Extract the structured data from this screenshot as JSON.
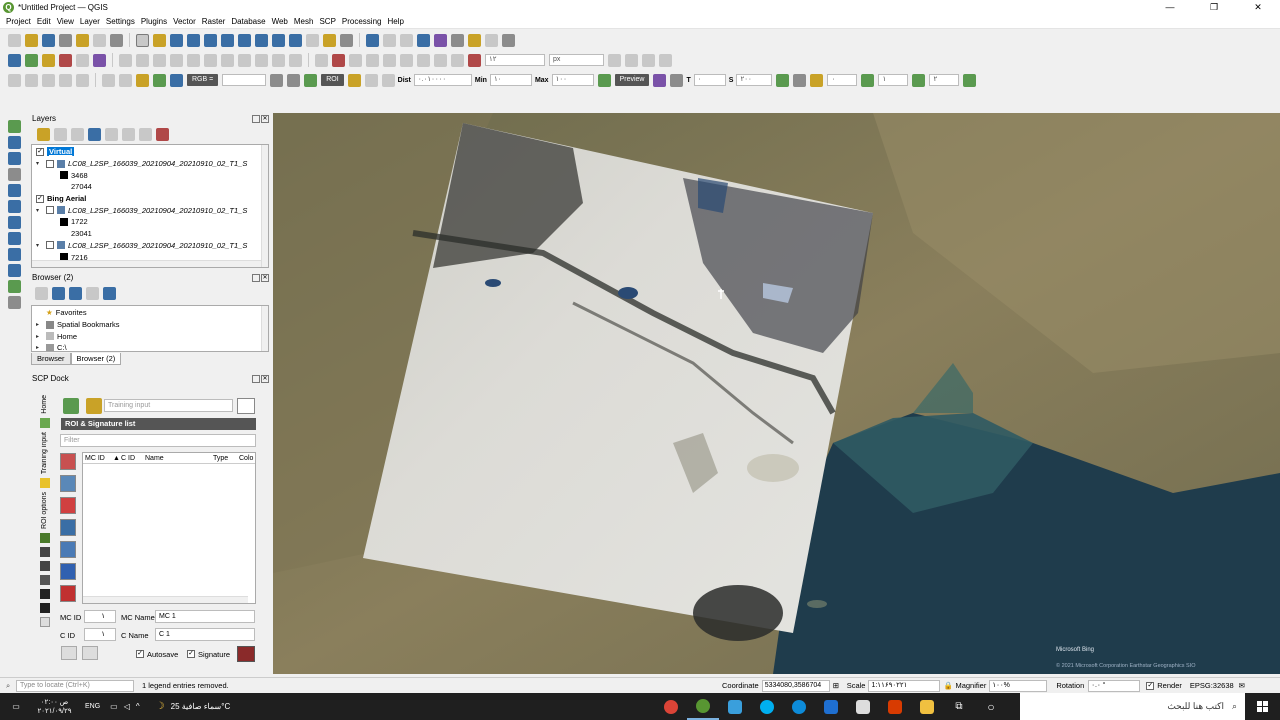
{
  "window": {
    "title": "*Untitled Project — QGIS",
    "logo": "Q",
    "min": "—",
    "max": "❐",
    "close": "✕"
  },
  "menu": [
    "Project",
    "Edit",
    "View",
    "Layer",
    "Settings",
    "Plugins",
    "Vector",
    "Raster",
    "Database",
    "Web",
    "Mesh",
    "SCP",
    "Processing",
    "Help"
  ],
  "toolbar3": {
    "rgb_label": "RGB =",
    "roi_label": "ROI",
    "dist_label": "Dist",
    "dist_value": "۰.۰۱۰۰۰۰",
    "min_label": "Min",
    "min_value": "۱۰",
    "max_label": "Max",
    "max_value": "۱۰۰",
    "preview_label": "Preview",
    "t_label": "T",
    "t_value": "۰",
    "s_label": "S",
    "s_value": "۲۰۰",
    "f1_value": "۰",
    "f2_value": "۱",
    "f3_value": "۲"
  },
  "toolbar2": {
    "value1": "۱۲",
    "unit": "px"
  },
  "layers_panel": {
    "title": "Layers",
    "rows": [
      {
        "text": "Virtual",
        "kind": "layer",
        "checked": true,
        "selected": true
      },
      {
        "text": "LC08_L2SP_166039_20210904_20210910_02_T1_S",
        "kind": "raster",
        "checked": false
      },
      {
        "text": "3468",
        "kind": "legend"
      },
      {
        "text": "27044",
        "kind": "legend"
      },
      {
        "text": "Bing Aerial",
        "kind": "layer",
        "checked": true,
        "bold": true
      },
      {
        "text": "LC08_L2SP_166039_20210904_20210910_02_T1_S",
        "kind": "raster",
        "checked": false
      },
      {
        "text": "1722",
        "kind": "legend"
      },
      {
        "text": "23041",
        "kind": "legend"
      },
      {
        "text": "LC08_L2SP_166039_20210904_20210910_02_T1_S",
        "kind": "raster",
        "checked": false
      },
      {
        "text": "7216",
        "kind": "legend"
      }
    ]
  },
  "browser_panel": {
    "title": "Browser (2)",
    "items": [
      "Favorites",
      "Spatial Bookmarks",
      "Home",
      "C:\\"
    ],
    "tabs": [
      "Browser",
      "Browser (2)"
    ]
  },
  "scp_dock": {
    "title": "SCP Dock",
    "training_placeholder": "Training input",
    "roi_list_title": "ROI & Signature list",
    "filter_placeholder": "Filter",
    "columns": [
      "MC ID",
      "C ID",
      "Name",
      "Type",
      "Colo"
    ],
    "vtabs": [
      "Home",
      "Training input",
      "ROI options"
    ],
    "mc_id_label": "MC ID",
    "mc_id_value": "۱",
    "mc_name_label": "MC Name",
    "mc_name_value": "MC 1",
    "c_id_label": "C ID",
    "c_id_value": "۱",
    "c_name_label": "C Name",
    "c_name_value": "C 1",
    "autosave_label": "Autosave",
    "signature_label": "Signature"
  },
  "statusbar": {
    "locate_placeholder": "Type to locate (Ctrl+K)",
    "message": "1 legend entries removed.",
    "coordinate_label": "Coordinate",
    "coordinate_value": "5334080,3586704",
    "scale_label": "Scale",
    "scale_value": "1:۱۱۶۹۰۲۲۱",
    "magnifier_label": "Magnifier",
    "magnifier_value": "۱۰۰%",
    "rotation_label": "Rotation",
    "rotation_value": "۰.۰ °",
    "render_label": "Render",
    "epsg_label": "EPSG:32638"
  },
  "map": {
    "attribution_logo": "Microsoft Bing",
    "attribution_text": "© 2021 Microsoft Corporation Earthstar Geographics SIO"
  },
  "taskbar": {
    "search_placeholder": "اكتب هنا للبحث",
    "weather": "سماء صافية  25°C",
    "lang": "ENG",
    "time": "۰۲:۰۰ ص",
    "date": "۲۰۲۱/۰۹/۲۹"
  }
}
